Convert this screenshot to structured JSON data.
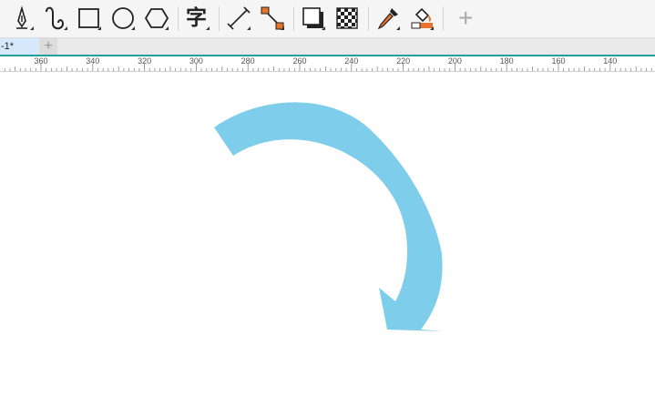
{
  "toolbar": {
    "tools": [
      {
        "name": "pen-tool-icon"
      },
      {
        "name": "freehand-tool-icon"
      },
      {
        "name": "rectangle-tool-icon"
      },
      {
        "name": "ellipse-tool-icon"
      },
      {
        "name": "polygon-tool-icon"
      },
      {
        "name": "text-tool-icon",
        "glyph": "字"
      },
      {
        "name": "dimension-tool-icon"
      },
      {
        "name": "connector-tool-icon"
      },
      {
        "name": "drop-shadow-tool-icon"
      },
      {
        "name": "transparency-tool-icon"
      },
      {
        "name": "eyedropper-tool-icon"
      },
      {
        "name": "interactive-fill-tool-icon"
      },
      {
        "name": "add-tool-icon",
        "glyph": "+"
      }
    ]
  },
  "tabs": {
    "document_tab": "-1*",
    "add_tab": "+"
  },
  "ruler": {
    "labels": [
      "360",
      "340",
      "320",
      "300",
      "280",
      "260",
      "240",
      "220",
      "200",
      "180",
      "160",
      "140"
    ]
  },
  "colors": {
    "accent": "#1fa39a",
    "arrow_fill": "#7ecdea",
    "fill_orange": "#e8732a"
  }
}
